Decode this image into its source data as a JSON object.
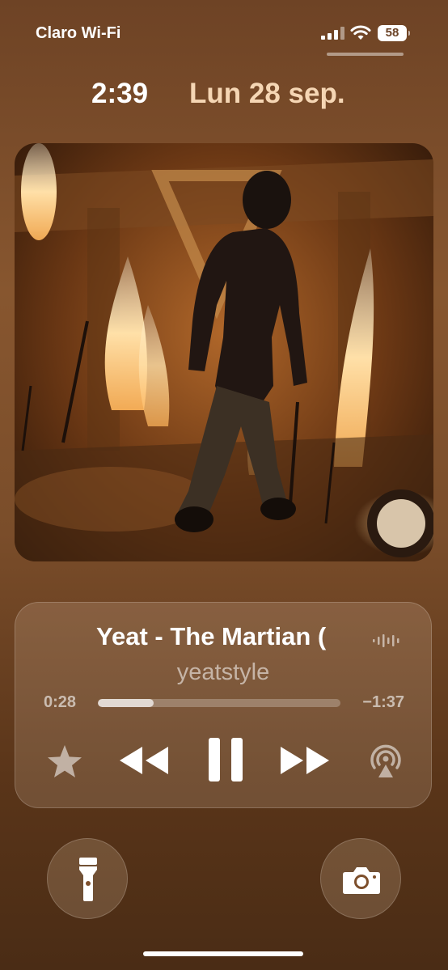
{
  "status_bar": {
    "carrier": "Claro Wi-Fi",
    "battery_level": "58",
    "signal_icon": "cellular-signal-icon",
    "wifi_icon": "wifi-icon"
  },
  "lock_screen": {
    "time": "2:39",
    "date": "Lun 28 sep."
  },
  "now_playing": {
    "title": "Yeat - The Martian (",
    "artist": "yeatstyle",
    "elapsed": "0:28",
    "remaining": "−1:37",
    "progress_fraction": 0.23,
    "controls": {
      "favorite_icon": "star-icon",
      "previous_icon": "rewind-icon",
      "play_pause_icon": "pause-icon",
      "next_icon": "fast-forward-icon",
      "output_icon": "airplay-audio-icon"
    }
  },
  "quick_actions": {
    "left_icon": "flashlight-icon",
    "right_icon": "camera-icon"
  },
  "colors": {
    "date_accent": "#f5d6b4",
    "background_top": "#6e4325",
    "background_bottom": "#4a2c15"
  }
}
